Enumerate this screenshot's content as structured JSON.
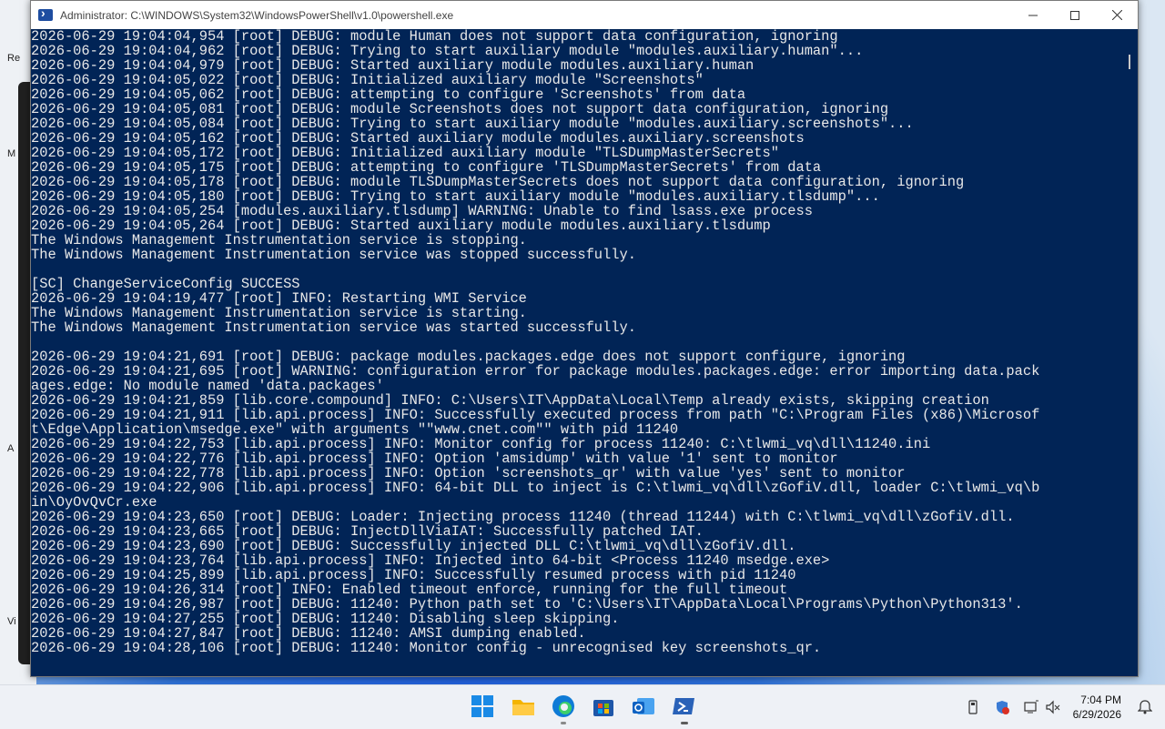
{
  "window": {
    "title": "Administrator: C:\\WINDOWS\\System32\\WindowsPowerShell\\v1.0\\powershell.exe",
    "controls": {
      "minimize": "—",
      "maximize": "☐",
      "close": "✕"
    }
  },
  "console_lines": [
    "2026-06-29 19:04:04,954 [root] DEBUG: module Human does not support data configuration, ignoring",
    "2026-06-29 19:04:04,962 [root] DEBUG: Trying to start auxiliary module \"modules.auxiliary.human\"...",
    "2026-06-29 19:04:04,979 [root] DEBUG: Started auxiliary module modules.auxiliary.human",
    "2026-06-29 19:04:05,022 [root] DEBUG: Initialized auxiliary module \"Screenshots\"",
    "2026-06-29 19:04:05,062 [root] DEBUG: attempting to configure 'Screenshots' from data",
    "2026-06-29 19:04:05,081 [root] DEBUG: module Screenshots does not support data configuration, ignoring",
    "2026-06-29 19:04:05,084 [root] DEBUG: Trying to start auxiliary module \"modules.auxiliary.screenshots\"...",
    "2026-06-29 19:04:05,162 [root] DEBUG: Started auxiliary module modules.auxiliary.screenshots",
    "2026-06-29 19:04:05,172 [root] DEBUG: Initialized auxiliary module \"TLSDumpMasterSecrets\"",
    "2026-06-29 19:04:05,175 [root] DEBUG: attempting to configure 'TLSDumpMasterSecrets' from data",
    "2026-06-29 19:04:05,178 [root] DEBUG: module TLSDumpMasterSecrets does not support data configuration, ignoring",
    "2026-06-29 19:04:05,180 [root] DEBUG: Trying to start auxiliary module \"modules.auxiliary.tlsdump\"...",
    "2026-06-29 19:04:05,254 [modules.auxiliary.tlsdump] WARNING: Unable to find lsass.exe process",
    "2026-06-29 19:04:05,264 [root] DEBUG: Started auxiliary module modules.auxiliary.tlsdump",
    "The Windows Management Instrumentation service is stopping.",
    "The Windows Management Instrumentation service was stopped successfully.",
    "",
    "[SC] ChangeServiceConfig SUCCESS",
    "2026-06-29 19:04:19,477 [root] INFO: Restarting WMI Service",
    "The Windows Management Instrumentation service is starting.",
    "The Windows Management Instrumentation service was started successfully.",
    "",
    "2026-06-29 19:04:21,691 [root] DEBUG: package modules.packages.edge does not support configure, ignoring",
    "2026-06-29 19:04:21,695 [root] WARNING: configuration error for package modules.packages.edge: error importing data.pack",
    "ages.edge: No module named 'data.packages'",
    "2026-06-29 19:04:21,859 [lib.core.compound] INFO: C:\\Users\\IT\\AppData\\Local\\Temp already exists, skipping creation",
    "2026-06-29 19:04:21,911 [lib.api.process] INFO: Successfully executed process from path \"C:\\Program Files (x86)\\Microsof",
    "t\\Edge\\Application\\msedge.exe\" with arguments \"\"www.cnet.com\"\" with pid 11240",
    "2026-06-29 19:04:22,753 [lib.api.process] INFO: Monitor config for process 11240: C:\\tlwmi_vq\\dll\\11240.ini",
    "2026-06-29 19:04:22,776 [lib.api.process] INFO: Option 'amsidump' with value '1' sent to monitor",
    "2026-06-29 19:04:22,778 [lib.api.process] INFO: Option 'screenshots_qr' with value 'yes' sent to monitor",
    "2026-06-29 19:04:22,906 [lib.api.process] INFO: 64-bit DLL to inject is C:\\tlwmi_vq\\dll\\zGofiV.dll, loader C:\\tlwmi_vq\\b",
    "in\\OyOvQvCr.exe",
    "2026-06-29 19:04:23,650 [root] DEBUG: Loader: Injecting process 11240 (thread 11244) with C:\\tlwmi_vq\\dll\\zGofiV.dll.",
    "2026-06-29 19:04:23,665 [root] DEBUG: InjectDllViaIAT: Successfully patched IAT.",
    "2026-06-29 19:04:23,690 [root] DEBUG: Successfully injected DLL C:\\tlwmi_vq\\dll\\zGofiV.dll.",
    "2026-06-29 19:04:23,764 [lib.api.process] INFO: Injected into 64-bit <Process 11240 msedge.exe>",
    "2026-06-29 19:04:25,899 [lib.api.process] INFO: Successfully resumed process with pid 11240",
    "2026-06-29 19:04:26,314 [root] INFO: Enabled timeout enforce, running for the full timeout",
    "2026-06-29 19:04:26,987 [root] DEBUG: 11240: Python path set to 'C:\\Users\\IT\\AppData\\Local\\Programs\\Python\\Python313'.",
    "2026-06-29 19:04:27,255 [root] DEBUG: 11240: Disabling sleep skipping.",
    "2026-06-29 19:04:27,847 [root] DEBUG: 11240: AMSI dumping enabled.",
    "2026-06-29 19:04:28,106 [root] DEBUG: 11240: Monitor config - unrecognised key screenshots_qr."
  ],
  "colors": {
    "console_bg": "#012456",
    "console_fg": "#e8e8e8",
    "taskbar_bg": "#eef1f6"
  },
  "taskbar": {
    "apps": [
      "start-icon",
      "file-explorer-icon",
      "edge-icon",
      "store-icon",
      "outlook-icon",
      "powershell-icon"
    ],
    "clock": {
      "time": "7:04 PM",
      "date": "6/29/2026"
    }
  },
  "background_fragments": [
    "Re",
    "M",
    "A",
    "Vi"
  ]
}
